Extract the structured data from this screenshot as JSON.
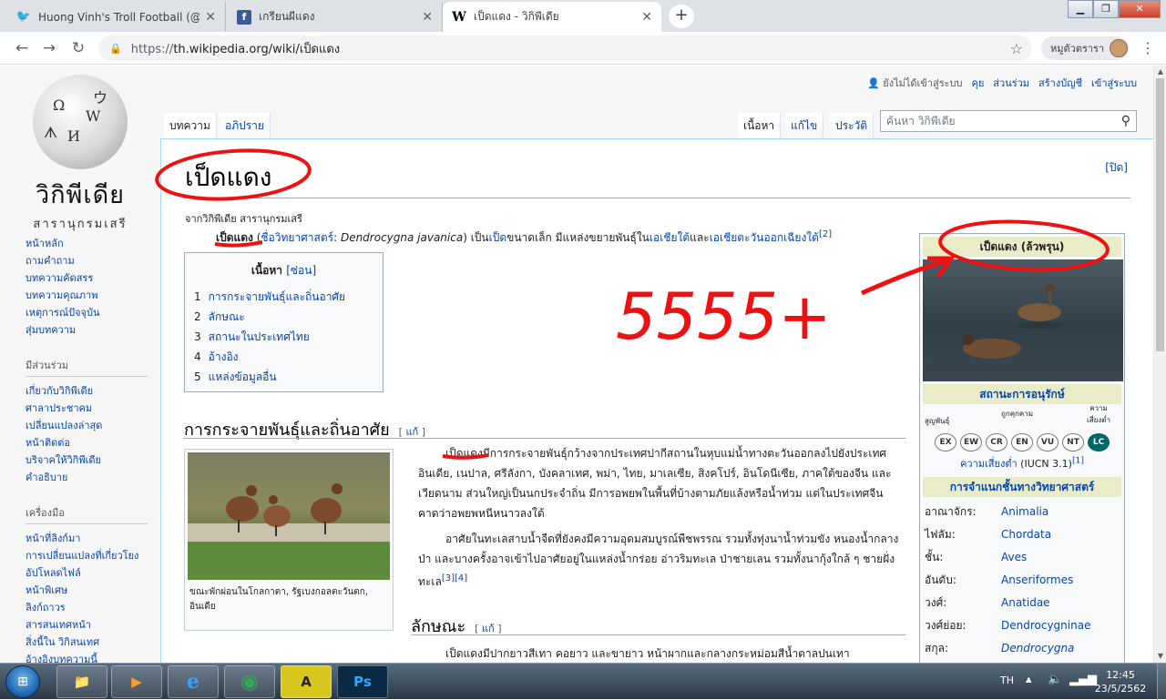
{
  "browser": {
    "tabs": [
      {
        "title": "Huong Vinh's Troll Football (@Vi",
        "favicon": "twitter-icon",
        "color": "#1da1f2",
        "glyph": "🐦"
      },
      {
        "title": "เกรียนผีแดง",
        "favicon": "facebook-icon",
        "color": "#3b5998",
        "glyph": "f"
      },
      {
        "title": "เป็ดแดง - วิกิพีเดีย",
        "favicon": "wikipedia-icon",
        "color": "#ffffff",
        "glyph": "W"
      }
    ],
    "new_tab": "+",
    "window_buttons": {
      "minimize": "▁",
      "maximize": "❐",
      "close": "✕"
    },
    "url_scheme": "https://",
    "url_rest": "th.wikipedia.org/wiki/เป็ดแดง",
    "profile_name": "หมูตัวตรารา",
    "back": "←",
    "forward": "→",
    "reload": "↻",
    "lock": "🔒",
    "bookmark": "☆",
    "menu": "⋮"
  },
  "wiki": {
    "logo_wordmark": "วิกิพีเดีย",
    "logo_tagline": "สารานุกรมเสรี",
    "personal": {
      "not_logged": "ยังไม่ได้เข้าสู่ระบบ",
      "links": [
        "คุย",
        "ส่วนร่วม",
        "สร้างบัญชี",
        "เข้าสู่ระบบ"
      ]
    },
    "tabs_left": [
      "บทความ",
      "อภิปราย"
    ],
    "tabs_right": [
      "เนื้อหา",
      "แก้ไข",
      "ประวัติ"
    ],
    "search_placeholder": "ค้นหา วิกิพีเดีย",
    "sidebar": {
      "main": [
        "หน้าหลัก",
        "ถามคำถาม",
        "บทความคัดสรร",
        "บทความคุณภาพ",
        "เหตุการณ์ปัจจุบัน",
        "สุ่มบทความ"
      ],
      "participate_title": "มีส่วนร่วม",
      "participate": [
        "เกี่ยวกับวิกิพีเดีย",
        "ศาลาประชาคม",
        "เปลี่ยนแปลงล่าสุด",
        "หน้าติดต่อ",
        "บริจาคให้วิกิพีเดีย",
        "คำอธิบาย"
      ],
      "tools_title": "เครื่องมือ",
      "tools": [
        "หน้าที่ลิงก์มา",
        "การเปลี่ยนแปลงที่เกี่ยวโยง",
        "อัปโหลดไฟล์",
        "หน้าพิเศษ",
        "ลิงก์ถาวร",
        "สารสนเทศหน้า",
        "สิ่งนี้ใน วิกิสนเทศ",
        "อ้างอิงบทความนี้"
      ]
    },
    "title": "เป็ดแดง",
    "close_link": "[ปิด]",
    "from": "จากวิกิพีเดีย สารานุกรมเสรี",
    "lead": {
      "name": "เป็ดแดง",
      "open": " (",
      "sci_label": "ชื่อวิทยาศาสตร์",
      "colon": ": ",
      "sci_name": "Dendrocygna javanica",
      "middle": ") เป็น",
      "duck": "เป็ด",
      "desc": "ขนาดเล็ก มีแหล่งขยายพันธุ์ใน",
      "region1": "เอเชียใต้",
      "and": "และ",
      "region2": "เอเชียตะวันออกเฉียงใต้",
      "ref": "[2]"
    },
    "toc": {
      "title": "เนื้อหา",
      "hide": "[ซ่อน]",
      "items": [
        {
          "num": "1",
          "label": "การกระจายพันธุ์และถิ่นอาศัย"
        },
        {
          "num": "2",
          "label": "ลักษณะ"
        },
        {
          "num": "3",
          "label": "สถานะในประเทศไทย"
        },
        {
          "num": "4",
          "label": "อ้างอิง"
        },
        {
          "num": "5",
          "label": "แหล่งข้อมูลอื่น"
        }
      ]
    },
    "section1": {
      "title": "การกระจายพันธุ์และถิ่นอาศัย",
      "edit": "แก้"
    },
    "section2": {
      "title": "ลักษณะ",
      "edit": "แก้"
    },
    "para1": "เป็ดแดงมีการกระจายพันธุ์กว้างจากประเทศปากีสถานในหุบแม่น้ำทางตะวันออกลงไปยังประเทศอินเดีย, เนปาล, ศรีลังกา, บังคลาเทศ, พม่า, ไทย, มาเลเซีย, สิงคโปร์, อินโดนีเซีย, ภาคใต้ของจีน และเวียดนาม ส่วนใหญ่เป็นนกประจำถิ่น มีการอพยพในพื้นที่บ้างตามภัยแล้งหรือน้ำท่วม แต่ในประเทศจีนคาดว่าอพยพหนีหนาวลงใต้",
    "para2": "อาศัยในทะเลสาบน้ำจืดที่ยังคงมีความอุดมสมบูรณ์พืชพรรณ รวมทั้งทุ่งนาน้ำท่วมขัง หนองน้ำกลางป่า และบางครั้งอาจเข้าไปอาศัยอยู่ในแหล่งน้ำกร่อย อ่าวริมทะเล ป่าชายเลน รวมทั้งนากุ้งใกล้ ๆ ชายฝั่งทะเล",
    "para2_ref": "[3][4]",
    "para3": "เป็ดแดงมีปากยาวสีเทา คอยาว และขายาว หน้าผากและกลางกระหม่อมสีน้ำตาลปนเทา",
    "thumb_caption": "ขณะพักผ่อนในโกลกาตา, รัฐเบงกอลตะวันตก, อินเดีย",
    "infobox": {
      "title": "เป็ดแดง (ล้วพรุน)",
      "status_title": "สถานะการอนุรักษ์",
      "label_extinct": "สูญพันธุ์",
      "label_threatened": "ถูกคุกคาม",
      "label_least": "ความเสี่ยงต่ำ",
      "scale": [
        "EX",
        "EW",
        "CR",
        "EN",
        "VU",
        "NT",
        "LC"
      ],
      "selected": "LC",
      "status_link": "ความเสี่ยงต่ำ",
      "status_source": " (IUCN 3.1)",
      "status_ref": "[1]",
      "taxonomy_title": "การจำแนกชั้นทางวิทยาศาสตร์",
      "taxonomy": [
        {
          "rank": "อาณาจักร:",
          "value": "Animalia"
        },
        {
          "rank": "ไฟลัม:",
          "value": "Chordata"
        },
        {
          "rank": "ชั้น:",
          "value": "Aves"
        },
        {
          "rank": "อันดับ:",
          "value": "Anseriformes"
        },
        {
          "rank": "วงศ์:",
          "value": "Anatidae"
        },
        {
          "rank": "วงศ์ย่อย:",
          "value": "Dendrocygninae"
        },
        {
          "rank": "สกุล:",
          "value": "Dendrocygna"
        }
      ]
    }
  },
  "annotation": {
    "scribble_text": "5555+",
    "color": "#ee1111"
  },
  "taskbar": {
    "start": "⊞",
    "apps": [
      {
        "name": "file-explorer",
        "glyph": "📁"
      },
      {
        "name": "media-player",
        "glyph": "▶"
      },
      {
        "name": "internet-explorer",
        "glyph": "e"
      },
      {
        "name": "chrome",
        "glyph": "◉"
      },
      {
        "name": "autocad",
        "glyph": "A"
      },
      {
        "name": "photoshop",
        "glyph": "Ps"
      }
    ],
    "lang": "TH",
    "time": "12:45",
    "date": "23/5/2562"
  }
}
